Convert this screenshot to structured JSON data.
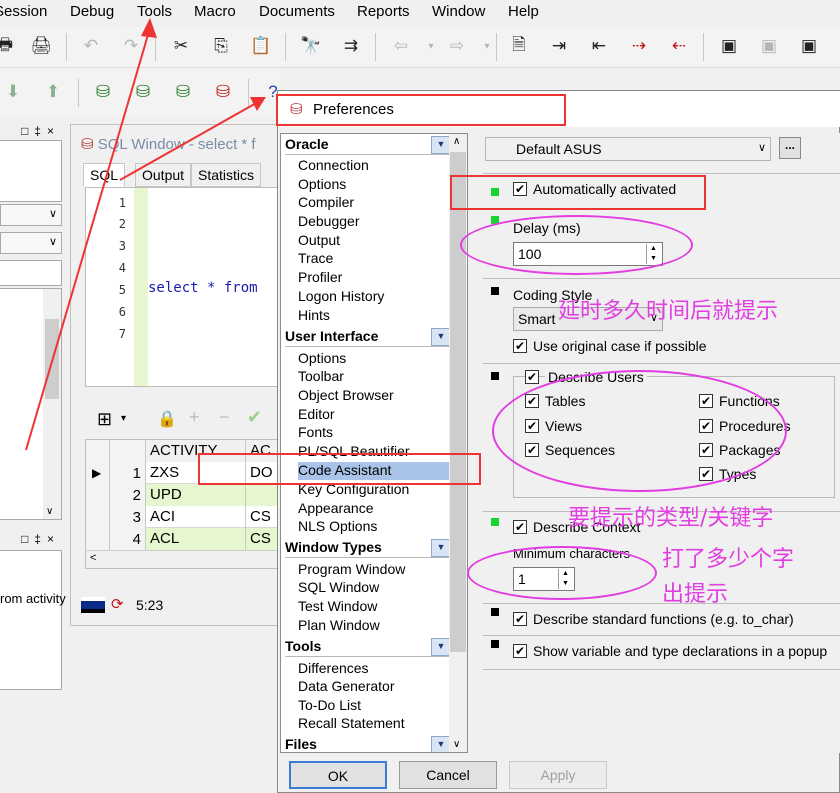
{
  "menu": [
    "Session",
    "Debug",
    "Tools",
    "Macro",
    "Documents",
    "Reports",
    "Window",
    "Help"
  ],
  "sql_window": {
    "title": "SQL Window - select * f",
    "tabs": [
      "SQL",
      "Output",
      "Statistics"
    ],
    "line_numbers": [
      "1",
      "2",
      "3",
      "4",
      "5",
      "6",
      "7"
    ],
    "code": "select * from",
    "grid": {
      "headers": [
        "ACTIVITY",
        "AC"
      ],
      "rows": [
        {
          "num": "1",
          "c1": "ZXS",
          "c2": "DO"
        },
        {
          "num": "2",
          "c1": "UPD",
          "c2": ""
        },
        {
          "num": "3",
          "c1": "ACI",
          "c2": "CS"
        },
        {
          "num": "4",
          "c1": "ACL",
          "c2": "CS"
        }
      ]
    },
    "status_time": "5:23"
  },
  "left_panel": {
    "activity_text": "rom activity"
  },
  "preferences": {
    "title": "Preferences",
    "tree": {
      "oracle": {
        "title": "Oracle",
        "items": [
          "Connection",
          "Options",
          "Compiler",
          "Debugger",
          "Output",
          "Trace",
          "Profiler",
          "Logon History",
          "Hints"
        ]
      },
      "user_interface": {
        "title": "User Interface",
        "items": [
          "Options",
          "Toolbar",
          "Object Browser",
          "Editor",
          "Fonts",
          "PL/SQL Beautifier",
          "Code Assistant",
          "Key Configuration",
          "Appearance",
          "NLS Options"
        ]
      },
      "window_types": {
        "title": "Window Types",
        "items": [
          "Program Window",
          "SQL Window",
          "Test Window",
          "Plan Window"
        ]
      },
      "tools": {
        "title": "Tools",
        "items": [
          "Differences",
          "Data Generator",
          "To-Do List",
          "Recall Statement"
        ]
      },
      "files": {
        "title": "Files"
      }
    },
    "profile": "Default ASUS",
    "profile_more": "...",
    "options": {
      "auto_activated": "Automatically activated",
      "delay_label": "Delay (ms)",
      "delay_value": "100",
      "coding_style_label": "Coding Style",
      "coding_style_value": "Smart",
      "use_original_case": "Use original case if possible",
      "describe_users": "Describe Users",
      "types_left": [
        "Tables",
        "Views",
        "Sequences"
      ],
      "types_right": [
        "Functions",
        "Procedures",
        "Packages",
        "Types"
      ],
      "describe_context": "Describe Context",
      "min_chars_label": "Minimum characters",
      "min_chars_value": "1",
      "describe_std_funcs": "Describe standard functions (e.g. to_char)",
      "show_var_decl": "Show variable and type declarations in a popup"
    },
    "buttons": {
      "ok": "OK",
      "cancel": "Cancel",
      "apply": "Apply"
    }
  },
  "annotations": {
    "delay_note": "延时多久时间后就提示",
    "types_note": "要提示的类型/关键字",
    "min_chars_note_1": "打了多少个字",
    "min_chars_note_2": "出提示"
  },
  "colors": {
    "annotation_red": "#ee3333",
    "annotation_magenta": "#e23de2",
    "tree_selection": "#a9c4e8",
    "green_marker": "#19d32f"
  }
}
